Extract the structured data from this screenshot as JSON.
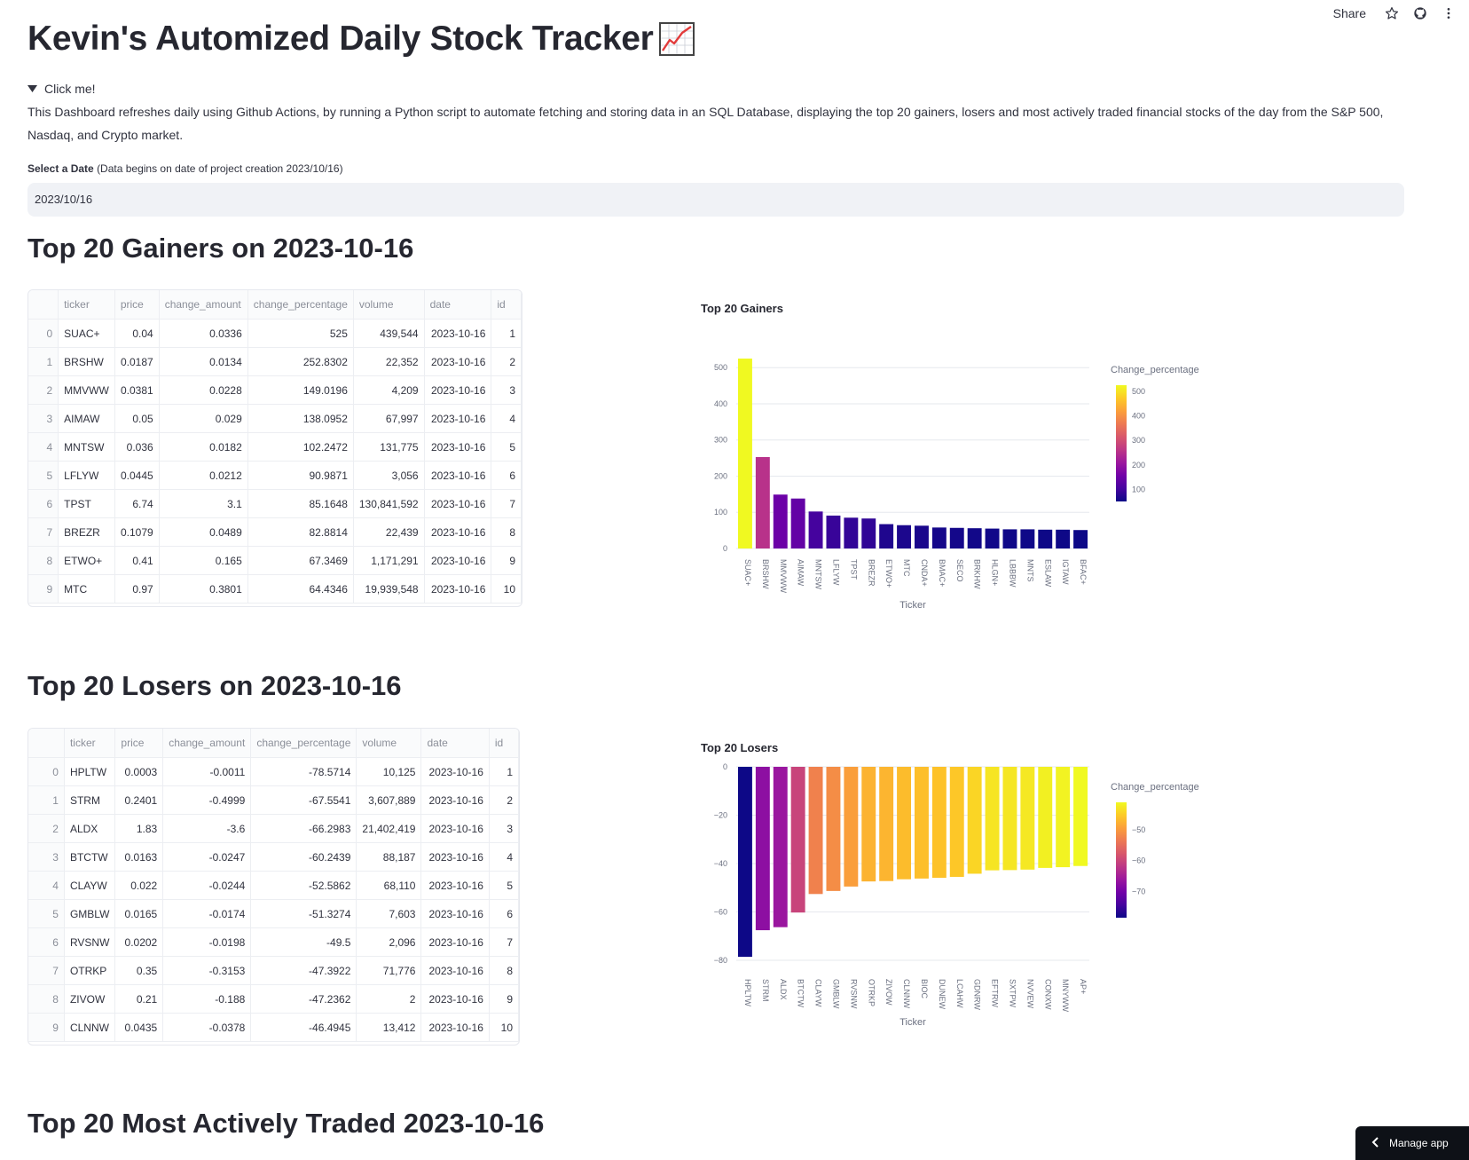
{
  "header": {
    "share_label": "Share",
    "icons": [
      "star-icon",
      "github-icon",
      "more-vert-icon"
    ]
  },
  "title": "Kevin's Automized Daily Stock Tracker",
  "expander_label": "Click me!",
  "description": "This Dashboard refreshes daily using Github Actions, by running a Python script to automate fetching and storing data in an SQL Database, displaying the top 20 gainers, losers and most actively traded financial stocks of the day from the S&P 500, Nasdaq, and Crypto market.",
  "date_picker": {
    "label": "Select a Date",
    "hint": "(Data begins on date of project creation 2023/10/16)",
    "value": "2023/10/16"
  },
  "gainers": {
    "heading": "Top 20 Gainers on 2023-10-16",
    "columns": [
      "",
      "ticker",
      "price",
      "change_amount",
      "change_percentage",
      "volume",
      "date",
      "id"
    ],
    "rows": [
      [
        "0",
        "SUAC+",
        "0.04",
        "0.0336",
        "525",
        "439,544",
        "2023-10-16",
        "1"
      ],
      [
        "1",
        "BRSHW",
        "0.0187",
        "0.0134",
        "252.8302",
        "22,352",
        "2023-10-16",
        "2"
      ],
      [
        "2",
        "MMVWW",
        "0.0381",
        "0.0228",
        "149.0196",
        "4,209",
        "2023-10-16",
        "3"
      ],
      [
        "3",
        "AIMAW",
        "0.05",
        "0.029",
        "138.0952",
        "67,997",
        "2023-10-16",
        "4"
      ],
      [
        "4",
        "MNTSW",
        "0.036",
        "0.0182",
        "102.2472",
        "131,775",
        "2023-10-16",
        "5"
      ],
      [
        "5",
        "LFLYW",
        "0.0445",
        "0.0212",
        "90.9871",
        "3,056",
        "2023-10-16",
        "6"
      ],
      [
        "6",
        "TPST",
        "6.74",
        "3.1",
        "85.1648",
        "130,841,592",
        "2023-10-16",
        "7"
      ],
      [
        "7",
        "BREZR",
        "0.1079",
        "0.0489",
        "82.8814",
        "22,439",
        "2023-10-16",
        "8"
      ],
      [
        "8",
        "ETWO+",
        "0.41",
        "0.165",
        "67.3469",
        "1,171,291",
        "2023-10-16",
        "9"
      ],
      [
        "9",
        "MTC",
        "0.97",
        "0.3801",
        "64.4346",
        "19,939,548",
        "2023-10-16",
        "10"
      ]
    ]
  },
  "losers": {
    "heading": "Top 20 Losers on 2023-10-16",
    "columns": [
      "",
      "ticker",
      "price",
      "change_amount",
      "change_percentage",
      "volume",
      "date",
      "id"
    ],
    "rows": [
      [
        "0",
        "HPLTW",
        "0.0003",
        "-0.0011",
        "-78.5714",
        "10,125",
        "2023-10-16",
        "1"
      ],
      [
        "1",
        "STRM",
        "0.2401",
        "-0.4999",
        "-67.5541",
        "3,607,889",
        "2023-10-16",
        "2"
      ],
      [
        "2",
        "ALDX",
        "1.83",
        "-3.6",
        "-66.2983",
        "21,402,419",
        "2023-10-16",
        "3"
      ],
      [
        "3",
        "BTCTW",
        "0.0163",
        "-0.0247",
        "-60.2439",
        "88,187",
        "2023-10-16",
        "4"
      ],
      [
        "4",
        "CLAYW",
        "0.022",
        "-0.0244",
        "-52.5862",
        "68,110",
        "2023-10-16",
        "5"
      ],
      [
        "5",
        "GMBLW",
        "0.0165",
        "-0.0174",
        "-51.3274",
        "7,603",
        "2023-10-16",
        "6"
      ],
      [
        "6",
        "RVSNW",
        "0.0202",
        "-0.0198",
        "-49.5",
        "2,096",
        "2023-10-16",
        "7"
      ],
      [
        "7",
        "OTRKP",
        "0.35",
        "-0.3153",
        "-47.3922",
        "71,776",
        "2023-10-16",
        "8"
      ],
      [
        "8",
        "ZIVOW",
        "0.21",
        "-0.188",
        "-47.2362",
        "2",
        "2023-10-16",
        "9"
      ],
      [
        "9",
        "CLNNW",
        "0.0435",
        "-0.0378",
        "-46.4945",
        "13,412",
        "2023-10-16",
        "10"
      ]
    ]
  },
  "active_heading": "Top 20 Most Actively Traded 2023-10-16",
  "manage_app_label": "Manage app",
  "chart_data": [
    {
      "type": "bar",
      "title": "Top 20 Gainers",
      "xlabel": "Ticker",
      "ylabel": "Change_percentage",
      "colorbar_title": "Change_percentage",
      "colorbar_ticks": [
        100,
        200,
        300,
        400,
        500
      ],
      "ylim": [
        0,
        525
      ],
      "yticks": [
        0,
        100,
        200,
        300,
        400,
        500
      ],
      "categories": [
        "SUAC+",
        "BRSHW",
        "MMVWW",
        "AIMAW",
        "MNTSW",
        "LFLYW",
        "TPST",
        "BREZR",
        "ETWO+",
        "MTC",
        "CNDA+",
        "BMAC+",
        "SECO",
        "BRKHW",
        "HLGN+",
        "LBBBW",
        "MNTS",
        "ESLAW",
        "IGTAW",
        "BFAC+"
      ],
      "values": [
        525,
        252.83,
        149.02,
        138.1,
        102.25,
        90.99,
        85.16,
        82.88,
        67.35,
        64.43,
        63,
        58,
        57,
        56,
        55,
        53,
        53,
        52,
        52,
        51
      ],
      "grid": true,
      "legend": "right"
    },
    {
      "type": "bar",
      "title": "Top 20 Losers",
      "xlabel": "Ticker",
      "ylabel": "Change_percentage",
      "colorbar_title": "Change_percentage",
      "colorbar_ticks": [
        -70,
        -60,
        -50
      ],
      "ylim": [
        -80,
        0
      ],
      "yticks": [
        0,
        -20,
        -40,
        -60,
        -80
      ],
      "categories": [
        "HPLTW",
        "STRM",
        "ALDX",
        "BTCTW",
        "CLAYW",
        "GMBLW",
        "RVSNW",
        "OTRKP",
        "ZIVOW",
        "CLNNW",
        "BIOC",
        "DUNEW",
        "LCAHW",
        "GDNRW",
        "EFTRW",
        "SXTPW",
        "NVVEW",
        "CONXW",
        "MNYWW",
        "AP+"
      ],
      "values": [
        -78.57,
        -67.55,
        -66.3,
        -60.24,
        -52.59,
        -51.33,
        -49.5,
        -47.39,
        -47.24,
        -46.49,
        -46.2,
        -45.9,
        -45.5,
        -44.2,
        -42.8,
        -42.7,
        -42.5,
        -41.8,
        -41.5,
        -41.0
      ],
      "grid": true,
      "legend": "right"
    }
  ]
}
